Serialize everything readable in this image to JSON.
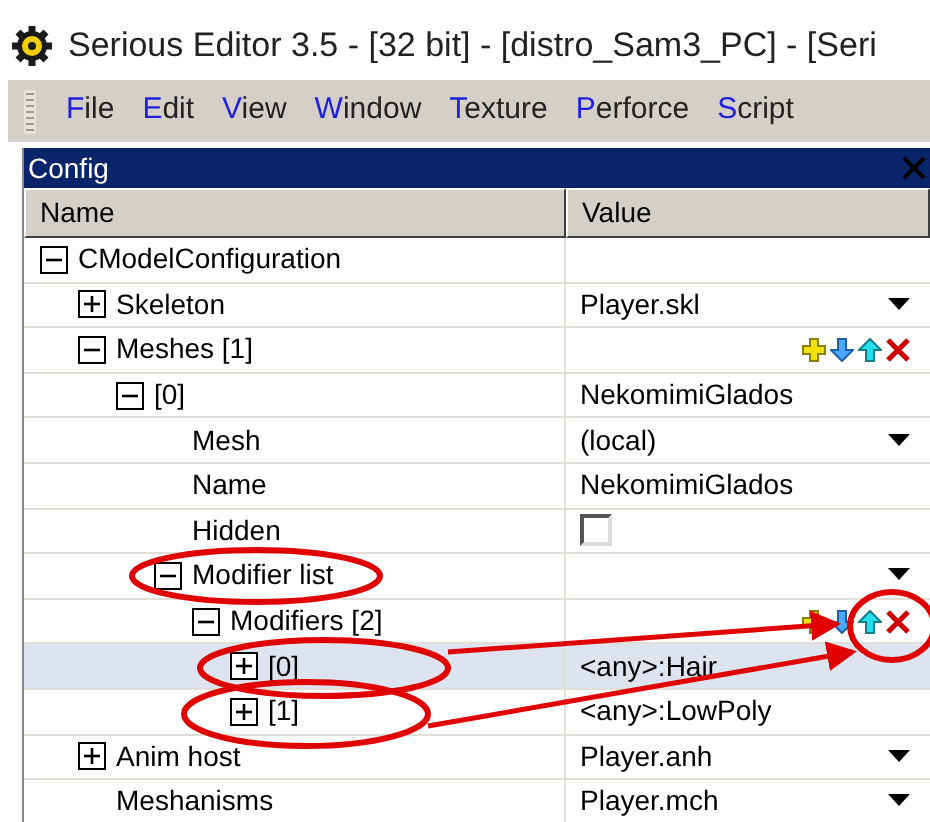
{
  "window": {
    "title": "Serious Editor 3.5 - [32 bit] - [distro_Sam3_PC] - [Seri"
  },
  "menu": [
    {
      "label": "File"
    },
    {
      "label": "Edit"
    },
    {
      "label": "View"
    },
    {
      "label": "Window"
    },
    {
      "label": "Texture"
    },
    {
      "label": "Perforce"
    },
    {
      "label": "Script"
    }
  ],
  "panel": {
    "title": "Config",
    "columns": [
      "Name",
      "Value"
    ],
    "rows": [
      {
        "name": "CModelConfiguration",
        "expanded": true,
        "selected": false,
        "children": [
          {
            "name": "Skeleton",
            "expanded": false,
            "selected": false,
            "value": {
              "kind": "dropdown",
              "text": "Player.skl"
            }
          },
          {
            "name": "Meshes [1]",
            "expanded": true,
            "selected": false,
            "value": {
              "kind": "array"
            },
            "children": [
              {
                "name": "[0]",
                "expanded": true,
                "selected": false,
                "value": {
                  "kind": "text",
                  "text": "NekomimiGlados"
                },
                "children": [
                  {
                    "name": "Mesh",
                    "selected": false,
                    "value": {
                      "kind": "dropdown",
                      "text": "(local)"
                    }
                  },
                  {
                    "name": "Name",
                    "selected": false,
                    "value": {
                      "kind": "text",
                      "text": "NekomimiGlados"
                    }
                  },
                  {
                    "name": "Hidden",
                    "selected": false,
                    "value": {
                      "kind": "checkbox",
                      "checked": false
                    }
                  },
                  {
                    "name": "Modifier list",
                    "expanded": true,
                    "selected": false,
                    "value": {
                      "kind": "dropdown"
                    },
                    "children": [
                      {
                        "name": "Modifiers [2]",
                        "expanded": true,
                        "selected": false,
                        "value": {
                          "kind": "array"
                        },
                        "children": [
                          {
                            "name": "[0]",
                            "expanded": false,
                            "selected": true,
                            "value": {
                              "kind": "text",
                              "text": "<any>:Hair"
                            }
                          },
                          {
                            "name": "[1]",
                            "expanded": false,
                            "selected": false,
                            "value": {
                              "kind": "text",
                              "text": "<any>:LowPoly"
                            }
                          }
                        ]
                      }
                    ]
                  }
                ]
              }
            ]
          },
          {
            "name": "Anim host",
            "expanded": false,
            "selected": false,
            "value": {
              "kind": "dropdown",
              "text": "Player.anh"
            }
          },
          {
            "name": "Meshanisms",
            "selected": false,
            "value": {
              "kind": "dropdown",
              "text": "Player.mch"
            }
          }
        ]
      }
    ]
  }
}
